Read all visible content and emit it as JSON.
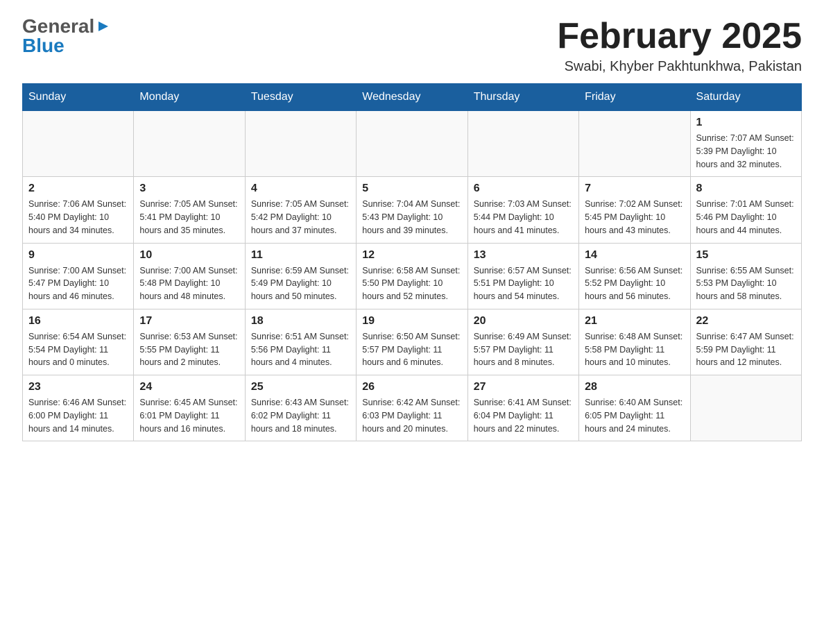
{
  "header": {
    "logo": {
      "general": "General",
      "arrow_icon": "arrow-right-icon",
      "blue": "Blue"
    },
    "title": "February 2025",
    "location": "Swabi, Khyber Pakhtunkhwa, Pakistan"
  },
  "calendar": {
    "weekdays": [
      "Sunday",
      "Monday",
      "Tuesday",
      "Wednesday",
      "Thursday",
      "Friday",
      "Saturday"
    ],
    "weeks": [
      [
        {
          "day": "",
          "info": ""
        },
        {
          "day": "",
          "info": ""
        },
        {
          "day": "",
          "info": ""
        },
        {
          "day": "",
          "info": ""
        },
        {
          "day": "",
          "info": ""
        },
        {
          "day": "",
          "info": ""
        },
        {
          "day": "1",
          "info": "Sunrise: 7:07 AM\nSunset: 5:39 PM\nDaylight: 10 hours\nand 32 minutes."
        }
      ],
      [
        {
          "day": "2",
          "info": "Sunrise: 7:06 AM\nSunset: 5:40 PM\nDaylight: 10 hours\nand 34 minutes."
        },
        {
          "day": "3",
          "info": "Sunrise: 7:05 AM\nSunset: 5:41 PM\nDaylight: 10 hours\nand 35 minutes."
        },
        {
          "day": "4",
          "info": "Sunrise: 7:05 AM\nSunset: 5:42 PM\nDaylight: 10 hours\nand 37 minutes."
        },
        {
          "day": "5",
          "info": "Sunrise: 7:04 AM\nSunset: 5:43 PM\nDaylight: 10 hours\nand 39 minutes."
        },
        {
          "day": "6",
          "info": "Sunrise: 7:03 AM\nSunset: 5:44 PM\nDaylight: 10 hours\nand 41 minutes."
        },
        {
          "day": "7",
          "info": "Sunrise: 7:02 AM\nSunset: 5:45 PM\nDaylight: 10 hours\nand 43 minutes."
        },
        {
          "day": "8",
          "info": "Sunrise: 7:01 AM\nSunset: 5:46 PM\nDaylight: 10 hours\nand 44 minutes."
        }
      ],
      [
        {
          "day": "9",
          "info": "Sunrise: 7:00 AM\nSunset: 5:47 PM\nDaylight: 10 hours\nand 46 minutes."
        },
        {
          "day": "10",
          "info": "Sunrise: 7:00 AM\nSunset: 5:48 PM\nDaylight: 10 hours\nand 48 minutes."
        },
        {
          "day": "11",
          "info": "Sunrise: 6:59 AM\nSunset: 5:49 PM\nDaylight: 10 hours\nand 50 minutes."
        },
        {
          "day": "12",
          "info": "Sunrise: 6:58 AM\nSunset: 5:50 PM\nDaylight: 10 hours\nand 52 minutes."
        },
        {
          "day": "13",
          "info": "Sunrise: 6:57 AM\nSunset: 5:51 PM\nDaylight: 10 hours\nand 54 minutes."
        },
        {
          "day": "14",
          "info": "Sunrise: 6:56 AM\nSunset: 5:52 PM\nDaylight: 10 hours\nand 56 minutes."
        },
        {
          "day": "15",
          "info": "Sunrise: 6:55 AM\nSunset: 5:53 PM\nDaylight: 10 hours\nand 58 minutes."
        }
      ],
      [
        {
          "day": "16",
          "info": "Sunrise: 6:54 AM\nSunset: 5:54 PM\nDaylight: 11 hours\nand 0 minutes."
        },
        {
          "day": "17",
          "info": "Sunrise: 6:53 AM\nSunset: 5:55 PM\nDaylight: 11 hours\nand 2 minutes."
        },
        {
          "day": "18",
          "info": "Sunrise: 6:51 AM\nSunset: 5:56 PM\nDaylight: 11 hours\nand 4 minutes."
        },
        {
          "day": "19",
          "info": "Sunrise: 6:50 AM\nSunset: 5:57 PM\nDaylight: 11 hours\nand 6 minutes."
        },
        {
          "day": "20",
          "info": "Sunrise: 6:49 AM\nSunset: 5:57 PM\nDaylight: 11 hours\nand 8 minutes."
        },
        {
          "day": "21",
          "info": "Sunrise: 6:48 AM\nSunset: 5:58 PM\nDaylight: 11 hours\nand 10 minutes."
        },
        {
          "day": "22",
          "info": "Sunrise: 6:47 AM\nSunset: 5:59 PM\nDaylight: 11 hours\nand 12 minutes."
        }
      ],
      [
        {
          "day": "23",
          "info": "Sunrise: 6:46 AM\nSunset: 6:00 PM\nDaylight: 11 hours\nand 14 minutes."
        },
        {
          "day": "24",
          "info": "Sunrise: 6:45 AM\nSunset: 6:01 PM\nDaylight: 11 hours\nand 16 minutes."
        },
        {
          "day": "25",
          "info": "Sunrise: 6:43 AM\nSunset: 6:02 PM\nDaylight: 11 hours\nand 18 minutes."
        },
        {
          "day": "26",
          "info": "Sunrise: 6:42 AM\nSunset: 6:03 PM\nDaylight: 11 hours\nand 20 minutes."
        },
        {
          "day": "27",
          "info": "Sunrise: 6:41 AM\nSunset: 6:04 PM\nDaylight: 11 hours\nand 22 minutes."
        },
        {
          "day": "28",
          "info": "Sunrise: 6:40 AM\nSunset: 6:05 PM\nDaylight: 11 hours\nand 24 minutes."
        },
        {
          "day": "",
          "info": ""
        }
      ]
    ]
  }
}
